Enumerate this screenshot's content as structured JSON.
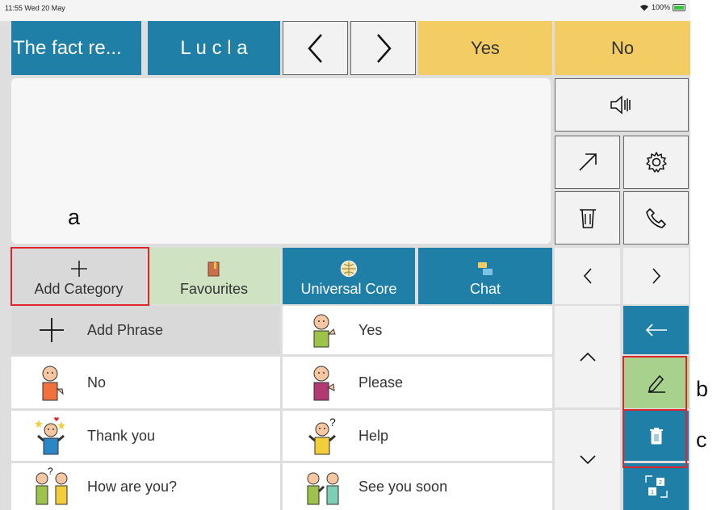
{
  "status_bar": {
    "time": "11:55",
    "date": "Wed 20 May",
    "battery": "100%"
  },
  "top_bar": {
    "phrase_preview": "The fact re...",
    "user_name": "L u c l a",
    "yes": "Yes",
    "no": "No"
  },
  "categories": [
    "Add Category",
    "Favourites",
    "Universal Core",
    "Chat"
  ],
  "phrases": [
    "Add Phrase",
    "Yes",
    "No",
    "Please",
    "Thank you",
    "Help",
    "How are you?",
    "See you soon"
  ],
  "annotations": {
    "a": "a",
    "b": "b",
    "c": "c"
  },
  "colors": {
    "accent_blue": "#1f7fa6",
    "accent_yellow": "#f3cd63",
    "favourites_green": "#cfe3c3",
    "edit_green": "#a8d18d",
    "highlight_red": "#e0242b"
  }
}
